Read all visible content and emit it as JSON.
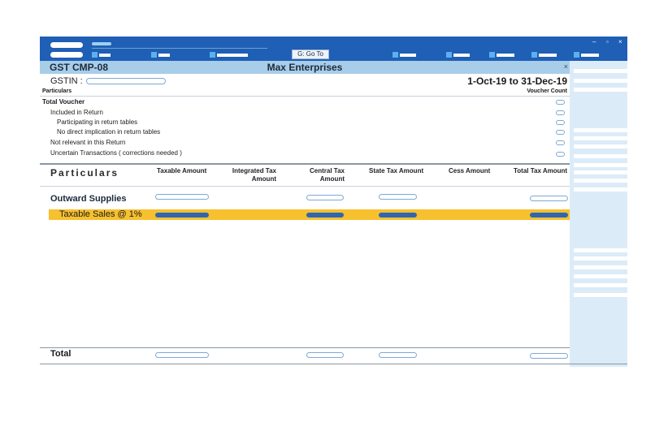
{
  "toolbar": {
    "goto_label": "G: Go To",
    "window_controls": [
      "–",
      "▫",
      "×"
    ]
  },
  "title_bar": {
    "report_name": "GST CMP-08",
    "company": "Max Enterprises",
    "close_glyph": "×"
  },
  "header": {
    "gstin_label": "GSTIN  :",
    "period": "1-Oct-19 to 31-Dec-19",
    "particulars_label": "Particulars",
    "voucher_count_label": "Voucher Count"
  },
  "voucher_rows": [
    {
      "label": "Total Voucher"
    },
    {
      "label": "Included in Return"
    },
    {
      "label": "Participating in return tables"
    },
    {
      "label": "No direct implication in return tables"
    },
    {
      "label": "Not relevant in this Return"
    },
    {
      "label": "Uncertain Transactions ( corrections needed )"
    }
  ],
  "table": {
    "particulars_header": "Particulars",
    "columns": {
      "taxable": "Taxable Amount",
      "integrated_1": "Integrated Tax",
      "integrated_2": "Amount",
      "central_1": "Central Tax",
      "central_2": "Amount",
      "state": "State Tax Amount",
      "cess": "Cess Amount",
      "total_tax": "Total Tax Amount"
    },
    "sections": {
      "outward": "Outward Supplies",
      "taxable_sales": "Taxable Sales @ 1%",
      "total": "Total"
    }
  }
}
